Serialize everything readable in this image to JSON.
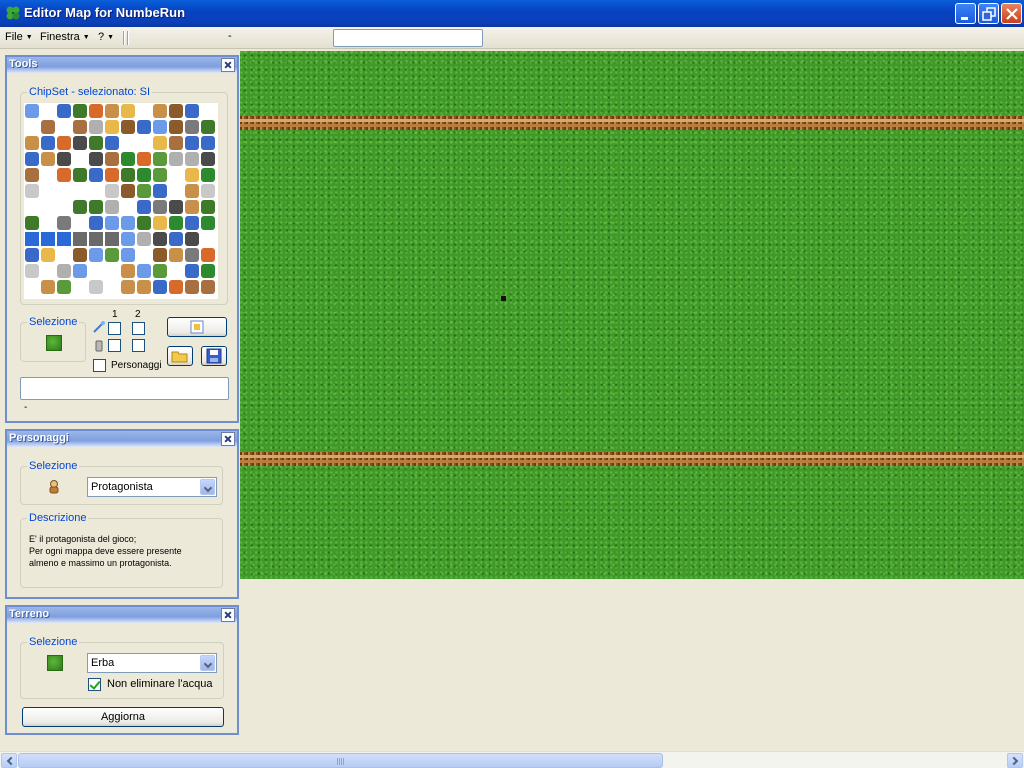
{
  "window": {
    "title": "Editor Map for NumbeRun"
  },
  "menubar": {
    "items": [
      "File",
      "Finestra",
      "?"
    ],
    "status": "-"
  },
  "tools_panel": {
    "title": "Tools",
    "chipset_legend": "ChipSet - selezionato: SI",
    "selection_legend": "Selezione",
    "layer_1_label": "1",
    "layer_2_label": "2",
    "characters_checkbox_label": "Personaggi",
    "footer_text": "-"
  },
  "characters_panel": {
    "title": "Personaggi",
    "selection_legend": "Selezione",
    "selected_character": "Protagonista",
    "description_legend": "Descrizione",
    "description_lines": [
      "E' il protagonista del gioco;",
      "Per ogni mappa deve essere presente",
      "almeno e massimo un protagonista."
    ]
  },
  "terrain_panel": {
    "title": "Terreno",
    "selection_legend": "Selezione",
    "selected_terrain": "Erba",
    "keep_water_label": "Non eliminare l'acqua",
    "keep_water_checked": true,
    "update_button": "Aggiorna"
  },
  "colors": {
    "grass": "#3f9a2a",
    "fence": "#a0642a",
    "title_bar": "#0a47c8",
    "panel_border": "#6e8ed0",
    "legend_text": "#0046d5"
  },
  "icons": [
    "app-clover-icon",
    "minimize-icon",
    "restore-icon",
    "close-icon",
    "wand-icon",
    "eraser-icon",
    "layers-icon",
    "open-folder-icon",
    "save-disk-icon",
    "character-icon"
  ]
}
